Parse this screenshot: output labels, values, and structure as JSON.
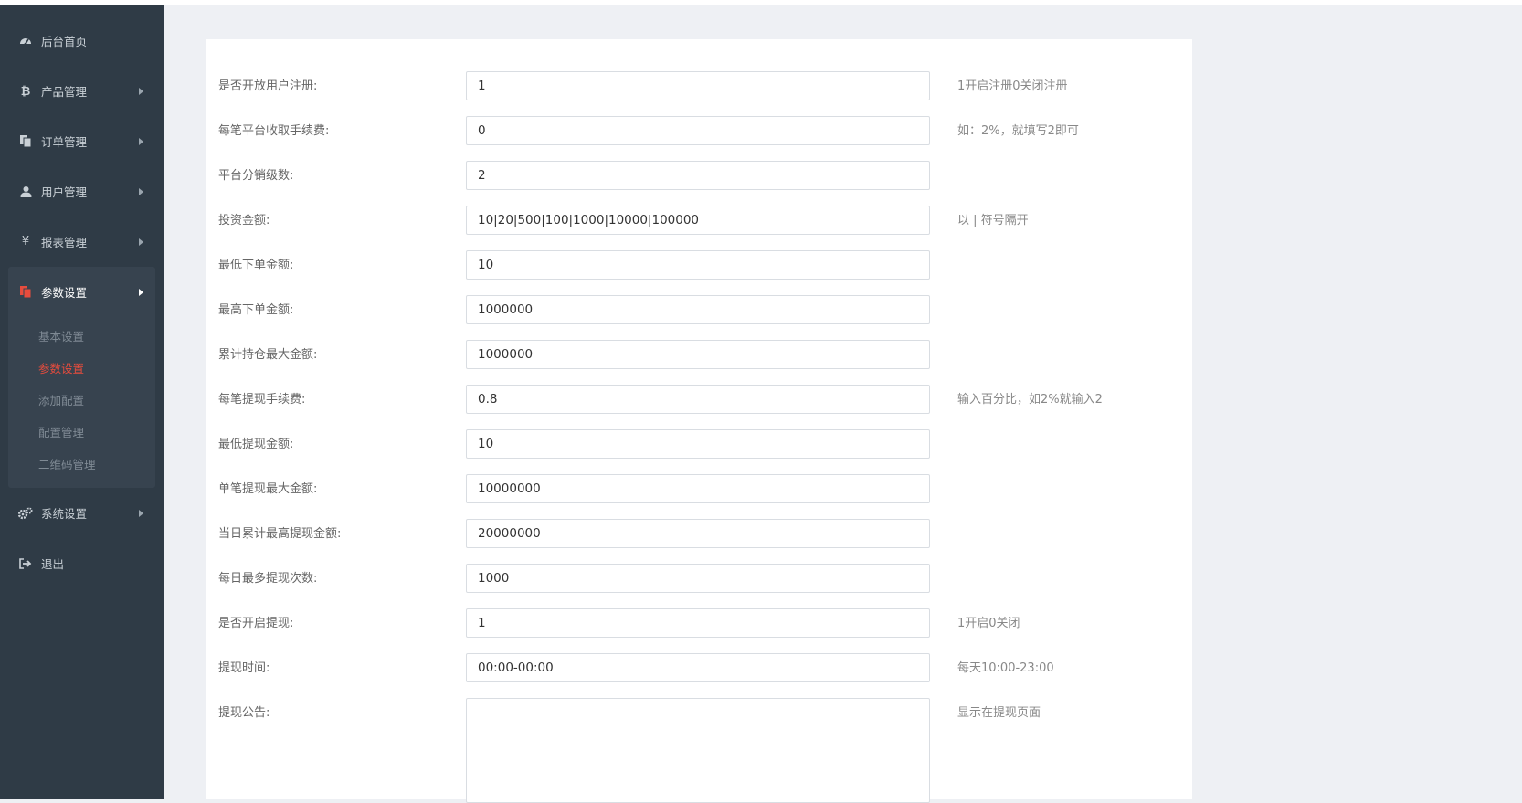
{
  "sidebar": {
    "items": [
      {
        "label": "后台首页",
        "icon": "dashboard-icon"
      },
      {
        "label": "产品管理",
        "icon": "bitcoin-icon"
      },
      {
        "label": "订单管理",
        "icon": "copy-icon"
      },
      {
        "label": "用户管理",
        "icon": "user-icon"
      },
      {
        "label": "报表管理",
        "icon": "yen-icon"
      },
      {
        "label": "参数设置",
        "icon": "copy-icon"
      },
      {
        "label": "系统设置",
        "icon": "gears-icon"
      },
      {
        "label": "退出",
        "icon": "sign-out-icon"
      }
    ],
    "active": "参数设置",
    "subitems": [
      {
        "label": "基本设置"
      },
      {
        "label": "参数设置"
      },
      {
        "label": "添加配置"
      },
      {
        "label": "配置管理"
      },
      {
        "label": "二维码管理"
      }
    ],
    "active_subitem": "参数设置"
  },
  "form": {
    "rows": [
      {
        "label": "是否开放用户注册:",
        "value": "1",
        "hint": "1开启注册0关闭注册"
      },
      {
        "label": "每笔平台收取手续费:",
        "value": "0",
        "hint": "如：2%，就填写2即可"
      },
      {
        "label": "平台分销级数:",
        "value": "2",
        "hint": ""
      },
      {
        "label": "投资金额:",
        "value": "10|20|500|100|1000|10000|100000",
        "hint": "以 | 符号隔开"
      },
      {
        "label": "最低下单金额:",
        "value": "10",
        "hint": ""
      },
      {
        "label": "最高下单金额:",
        "value": "1000000",
        "hint": ""
      },
      {
        "label": "累计持仓最大金额:",
        "value": "1000000",
        "hint": ""
      },
      {
        "label": "每笔提现手续费:",
        "value": "0.8",
        "hint": "输入百分比，如2%就输入2"
      },
      {
        "label": "最低提现金额:",
        "value": "10",
        "hint": ""
      },
      {
        "label": "单笔提现最大金额:",
        "value": "10000000",
        "hint": ""
      },
      {
        "label": "当日累计最高提现金额:",
        "value": "20000000",
        "hint": ""
      },
      {
        "label": "每日最多提现次数:",
        "value": "1000",
        "hint": ""
      },
      {
        "label": "是否开启提现:",
        "value": "1",
        "hint": "1开启0关闭"
      },
      {
        "label": "提现时间:",
        "value": "00:00-00:00",
        "hint": "每天10:00-23:00"
      }
    ],
    "notice": {
      "label": "提现公告:",
      "value": "",
      "hint": "显示在提现页面"
    }
  },
  "colors": {
    "sidebar_bg": "#2f3b46",
    "active_red": "#e84c3d",
    "page_bg": "#eef0f4"
  }
}
